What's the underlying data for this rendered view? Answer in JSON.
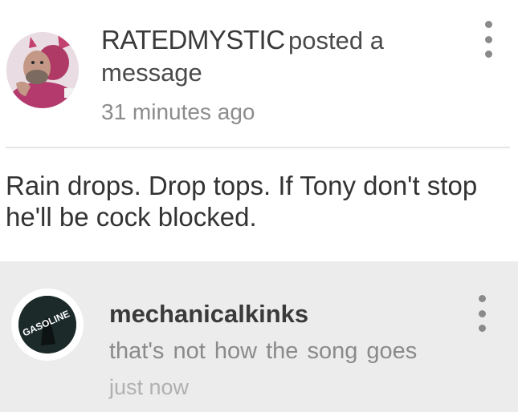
{
  "post": {
    "username": "RATEDMYSTIC",
    "action_text": "posted a message",
    "timestamp": "31 minutes ago",
    "body": "Rain drops. Drop tops. If Tony don't stop he'll be cock blocked.",
    "avatar_icon": "user-avatar-photo",
    "menu_icon": "more-vert-icon"
  },
  "comment": {
    "username": "mechanicalkinks",
    "text": "that's not how the song goes",
    "timestamp": "just now",
    "avatar_text": "GASOLINE",
    "avatar_icon": "album-art-avatar",
    "menu_icon": "more-vert-icon"
  },
  "colors": {
    "comment_background": "#ececec",
    "divider": "#e5e5e5",
    "username": "#3a3a3a",
    "timestamp": "#8c8c8c"
  }
}
